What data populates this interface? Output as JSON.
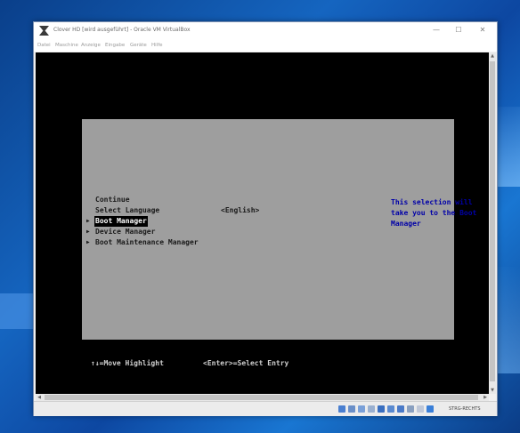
{
  "window": {
    "title": "Clover HD [wird ausgeführt] - Oracle VM VirtualBox",
    "minimize": "—",
    "maximize": "☐",
    "close": "✕"
  },
  "menu": [
    "Datei",
    "Maschine",
    "Anzeige",
    "Eingabe",
    "Geräte",
    "Hilfe"
  ],
  "bios": {
    "items": [
      {
        "label": "Continue",
        "arrow": false,
        "selected": false
      },
      {
        "label": "Select Language",
        "arrow": false,
        "selected": false
      },
      {
        "label": "Boot Manager",
        "arrow": true,
        "selected": true
      },
      {
        "label": "Device Manager",
        "arrow": true,
        "selected": false
      },
      {
        "label": "Boot Maintenance Manager",
        "arrow": true,
        "selected": false
      }
    ],
    "language_value": "<English>",
    "help_text": "This selection will take you to the Boot Manager",
    "footer_move": "↑↓=Move Highlight",
    "footer_enter": "<Enter>=Select Entry"
  },
  "statusbar": {
    "hostkey_label": "STRG-RECHTS"
  },
  "colors": {
    "bios_background": "#9e9e9e",
    "help_text": "#0000a8",
    "screen": "#000000"
  }
}
